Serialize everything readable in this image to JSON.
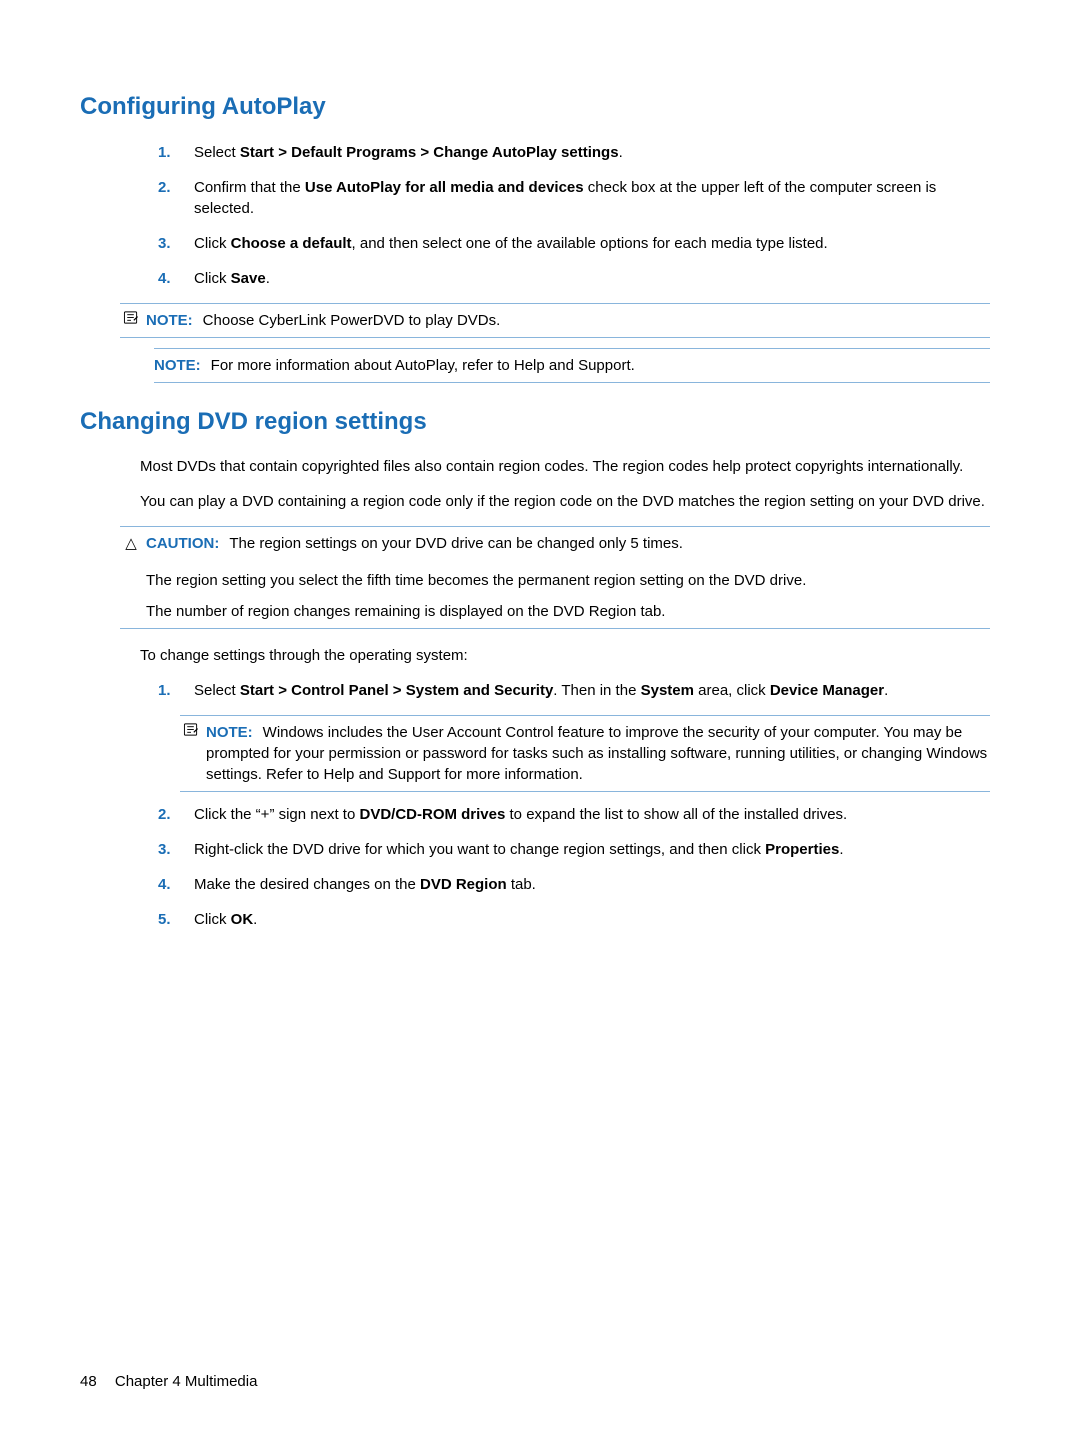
{
  "section1": {
    "heading": "Configuring AutoPlay",
    "items": [
      {
        "num": "1.",
        "pre": "Select ",
        "bold": "Start > Default Programs > Change AutoPlay settings",
        "post": "."
      },
      {
        "num": "2.",
        "pre": "Confirm that the ",
        "bold": "Use AutoPlay for all media and devices",
        "post": " check box at the upper left of the computer screen is selected."
      },
      {
        "num": "3.",
        "pre": "Click ",
        "bold": "Choose a default",
        "post": ", and then select one of the available options for each media type listed."
      },
      {
        "num": "4.",
        "pre": "Click ",
        "bold": "Save",
        "post": "."
      }
    ],
    "note1": {
      "label": "NOTE:",
      "text": "Choose CyberLink PowerDVD to play DVDs."
    },
    "note2": {
      "label": "NOTE:",
      "text": "For more information about AutoPlay, refer to Help and Support."
    }
  },
  "section2": {
    "heading": "Changing DVD region settings",
    "para1": "Most DVDs that contain copyrighted files also contain region codes. The region codes help protect copyrights internationally.",
    "para2": "You can play a DVD containing a region code only if the region code on the DVD matches the region setting on your DVD drive.",
    "caution": {
      "label": "CAUTION:",
      "line1": "The region settings on your DVD drive can be changed only 5 times.",
      "line2": "The region setting you select the fifth time becomes the permanent region setting on the DVD drive.",
      "line3": "The number of region changes remaining is displayed on the DVD Region tab."
    },
    "para3": "To change settings through the operating system:",
    "items": [
      {
        "num": "1.",
        "pre": "Select ",
        "bold": "Start > Control Panel > System and Security",
        "mid": ". Then in the ",
        "bold2": "System",
        "mid2": " area, click ",
        "bold3": "Device Manager",
        "post": "."
      },
      {
        "num": "2.",
        "pre": "Click the “+” sign next to ",
        "bold": "DVD/CD-ROM drives",
        "post": " to expand the list to show all of the installed drives."
      },
      {
        "num": "3.",
        "pre": "Right-click the DVD drive for which you want to change region settings, and then click ",
        "bold": "Properties",
        "post": "."
      },
      {
        "num": "4.",
        "pre": "Make the desired changes on the ",
        "bold": "DVD Region",
        "post": " tab."
      },
      {
        "num": "5.",
        "pre": "Click ",
        "bold": "OK",
        "post": "."
      }
    ],
    "nestedNote": {
      "label": "NOTE:",
      "text": "Windows includes the User Account Control feature to improve the security of your computer. You may be prompted for your permission or password for tasks such as installing software, running utilities, or changing Windows settings. Refer to Help and Support for more information."
    }
  },
  "footer": {
    "pageNum": "48",
    "chapter": "Chapter 4   Multimedia"
  }
}
